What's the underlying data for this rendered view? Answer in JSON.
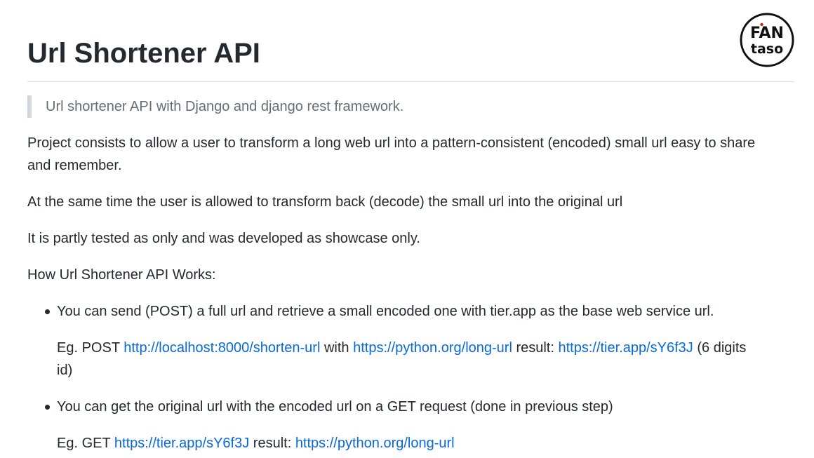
{
  "title": "Url Shortener API",
  "logo": {
    "line1": "FAN",
    "line2": "taso"
  },
  "blockquote": "Url shortener API with Django and django rest framework.",
  "paragraphs": {
    "p1": "Project consists to allow a user to transform a long web url into a pattern-consistent (encoded) small url easy to share",
    "p1b": "and remember.",
    "p2": "At the same time the user is allowed to transform back (decode) the small url into the original url",
    "p3": "It is partly tested as only and was developed as showcase only.",
    "p4": "How Url Shortener API Works:"
  },
  "list": {
    "item1": {
      "text": "You can send (POST) a full url and retrieve a small encoded one with tier.app as the base web service url.",
      "eg_prefix": "Eg. POST ",
      "link1": "http://localhost:8000/shorten-url",
      "with": " with ",
      "link2": "https://python.org/long-url",
      "result": " result: ",
      "link3": "https://tier.app/sY6f3J",
      "suffix": " (6 digits",
      "suffix2": "id)"
    },
    "item2": {
      "text": "You can get the original url with the encoded url on a GET request (done in previous step)",
      "eg_prefix": "Eg. GET ",
      "link1": "https://tier.app/sY6f3J",
      "result": " result: ",
      "link2": "https://python.org/long-url"
    }
  },
  "colors": {
    "text": "#24292f",
    "muted": "#656d76",
    "link": "#0969da",
    "border": "#d8dee4"
  }
}
